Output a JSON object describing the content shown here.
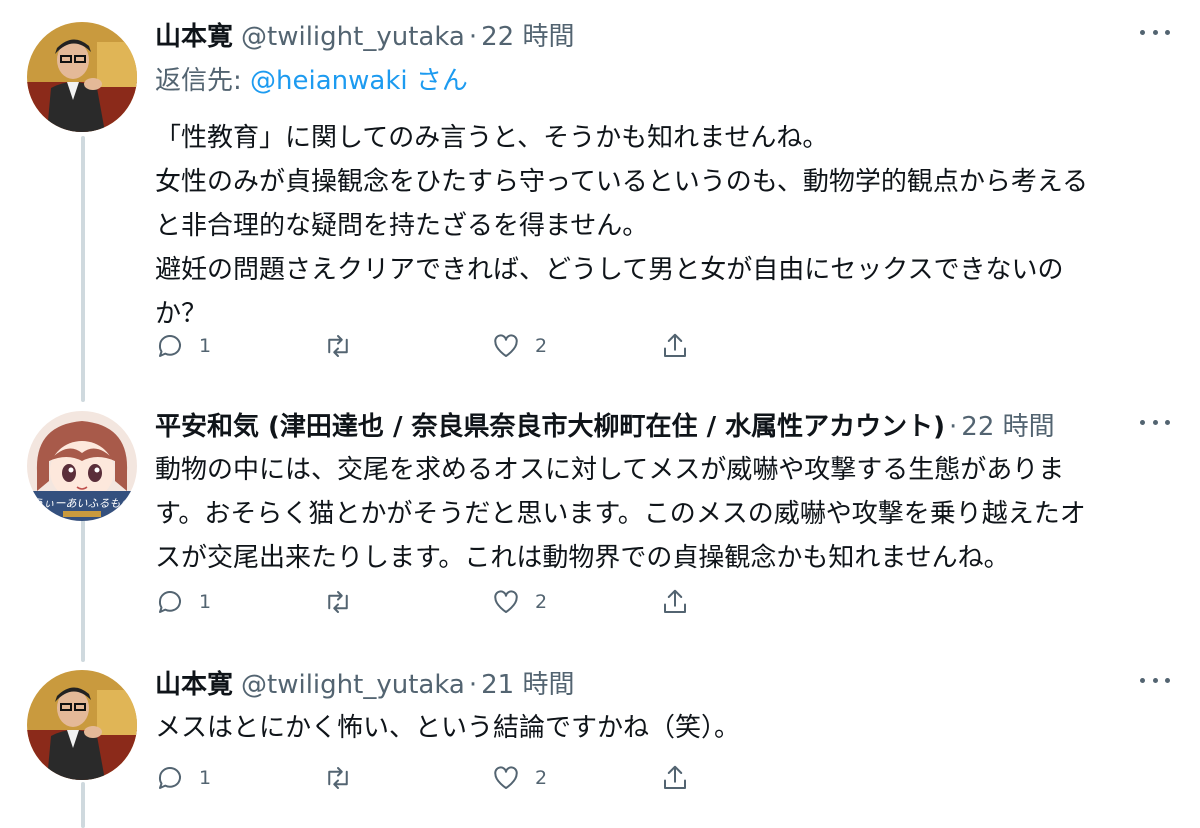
{
  "tweets": [
    {
      "name": "山本寛",
      "handle": "@twilight_yutaka",
      "separator": "·",
      "time": "22 時間",
      "reply_prefix": "返信先: ",
      "reply_to": "@heianwaki",
      "reply_suffix": " さん",
      "text": "「性教育」に関してのみ言うと、そうかも知れませんね。\n女性のみが貞操観念をひたすら守っているというのも、動物学的観点から考える\nと非合理的な疑問を持たざるを得ません。\n避妊の問題さえクリアできれば、どうして男と女が自由にセックスできないの\nか？",
      "reply_count": "1",
      "retweet_count": "",
      "like_count": "2"
    },
    {
      "name": "平安和気 (津田達也 / 奈良県奈良市大柳町在住 / 水属性アカウント)",
      "handle": "",
      "separator": "·",
      "time": "22 時間",
      "text": "動物の中には、交尾を求めるオスに対してメスが威嚇や攻撃する生態がありま\nす。おそらく猫とかがそうだと思います。このメスの威嚇や攻撃を乗り越えたオ\nスが交尾出来たりします。これは動物界での貞操観念かも知れませんね。",
      "reply_count": "1",
      "retweet_count": "",
      "like_count": "2",
      "avatar_text": "うぃーあいふるもの"
    },
    {
      "name": "山本寛",
      "handle": "@twilight_yutaka",
      "separator": "·",
      "time": "21 時間",
      "text": "メスはとにかく怖い、という結論ですかね（笑）。",
      "reply_count": "1",
      "retweet_count": "",
      "like_count": "2"
    }
  ],
  "icons": {
    "reply": "reply-icon",
    "retweet": "retweet-icon",
    "like": "heart-icon",
    "share": "share-icon",
    "more": "more-icon"
  },
  "colors": {
    "text": "#0f1419",
    "secondary": "#536471",
    "link": "#1d9bf0",
    "thread_line": "#cfd9de"
  }
}
